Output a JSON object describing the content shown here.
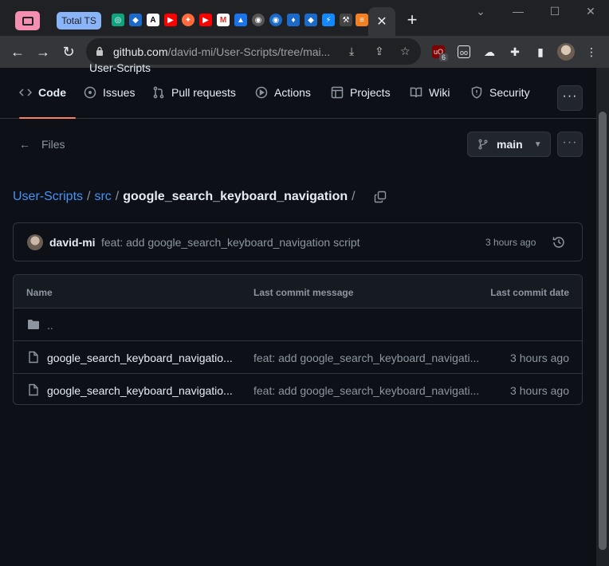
{
  "browser": {
    "pinned_tab_label": "Total TS",
    "active_tab_close": "✕",
    "new_tab": "+",
    "window_controls": [
      "⌄",
      "—",
      "☐",
      "✕"
    ],
    "url_host": "github.com",
    "url_path": "/david-mi/User-Scripts/tree/mai...",
    "extension_badge": "6"
  },
  "repo_nav": {
    "partial_title": "User-Scripts",
    "tabs": [
      {
        "label": "Code",
        "icon": "code-icon"
      },
      {
        "label": "Issues",
        "icon": "issue-opened-icon"
      },
      {
        "label": "Pull requests",
        "icon": "git-pull-request-icon"
      },
      {
        "label": "Actions",
        "icon": "play-icon"
      },
      {
        "label": "Projects",
        "icon": "table-icon"
      },
      {
        "label": "Wiki",
        "icon": "book-icon"
      },
      {
        "label": "Security",
        "icon": "shield-icon"
      }
    ],
    "more_label": "···"
  },
  "files_header": {
    "back_label": "Files",
    "branch": "main",
    "more_label": "···"
  },
  "breadcrumb": {
    "repo": "User-Scripts",
    "folder": "src",
    "current": "google_search_keyboard_navigation",
    "sep": "/"
  },
  "latest_commit": {
    "author": "david-mi",
    "message": "feat: add google_search_keyboard_navigation script",
    "time": "3 hours ago"
  },
  "file_table": {
    "headers": {
      "name": "Name",
      "message": "Last commit message",
      "date": "Last commit date"
    },
    "rows": [
      {
        "name": "..",
        "message": "",
        "date": "",
        "type": "folder"
      },
      {
        "name": "google_search_keyboard_navigatio...",
        "message": "feat: add google_search_keyboard_navigati...",
        "date": "3 hours ago",
        "type": "file"
      },
      {
        "name": "google_search_keyboard_navigatio...",
        "message": "feat: add google_search_keyboard_navigati...",
        "date": "3 hours ago",
        "type": "file"
      }
    ]
  },
  "colors": {
    "accent": "#4493f8",
    "underline": "#f78166",
    "bg": "#0d1117"
  }
}
